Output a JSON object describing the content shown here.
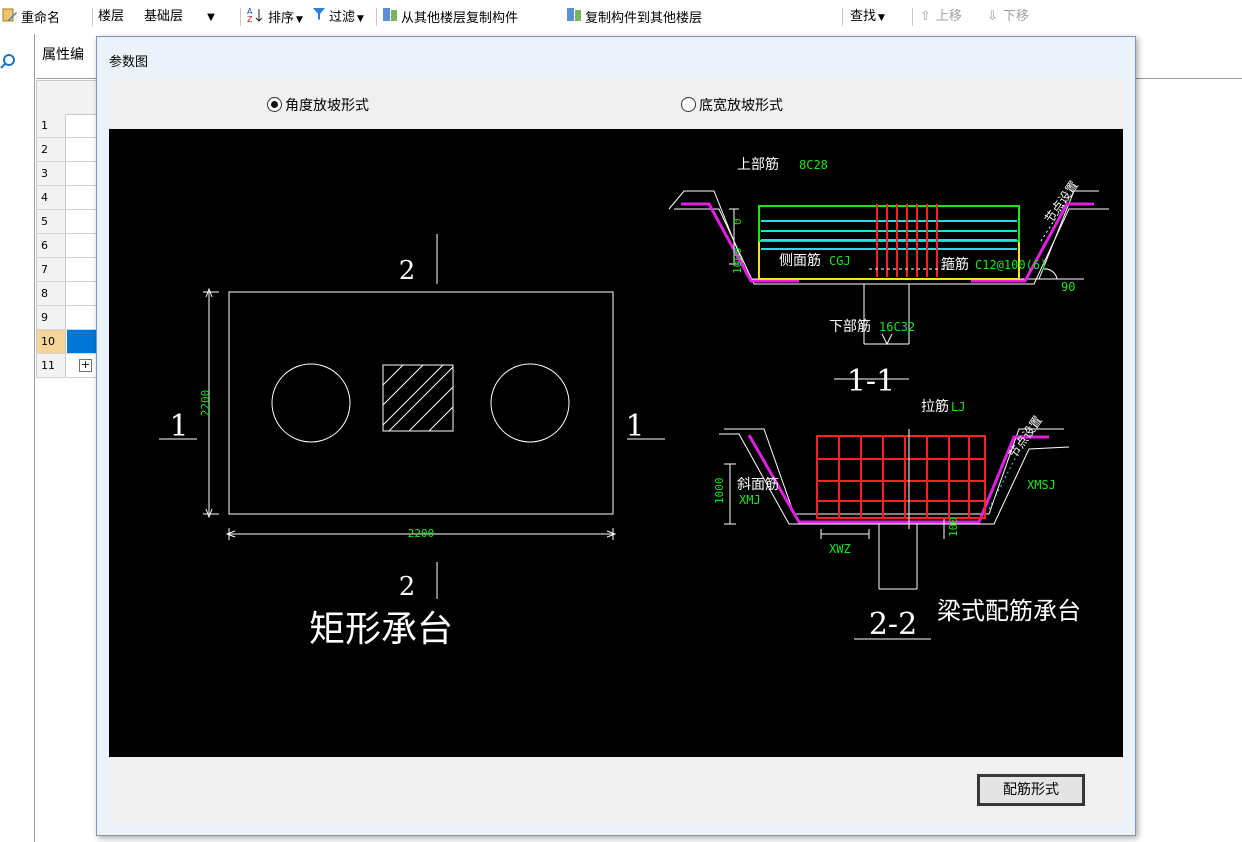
{
  "toolbar": {
    "rename": "重命名",
    "floor_label": "楼层",
    "floor_value": "基础层",
    "sort": "排序",
    "filter": "过滤",
    "copy_from": "从其他楼层复制构件",
    "copy_to": "复制构件到其他楼层",
    "find": "查找",
    "move_up": "上移",
    "move_down": "下移"
  },
  "panel": {
    "tab_label": "属性编"
  },
  "grid": {
    "rows": [
      "1",
      "2",
      "3",
      "4",
      "5",
      "6",
      "7",
      "8",
      "9",
      "10",
      "11"
    ],
    "selected_row": "10",
    "expand_symbol": "+"
  },
  "dialog": {
    "title": "参数图",
    "radio_angle": "角度放坡形式",
    "radio_width": "底宽放坡形式",
    "button": "配筋形式"
  },
  "drawing": {
    "left": {
      "dim_w": "2200",
      "dim_h": "2200",
      "sec1": "1",
      "sec2": "2",
      "caption": "矩形承台"
    },
    "s11": {
      "top_bar": "上部筋",
      "top_bar_val": "8C28",
      "side_bar": "侧面筋",
      "side_bar_val": "CGJ",
      "stirrup": "箍筋",
      "stirrup_val": "C12@100(6)",
      "bottom_bar": "下部筋",
      "bottom_bar_val": "16C32",
      "dim_zero": "0",
      "dim_h": "1000",
      "angle": "90",
      "note": "节点设置",
      "label": "1-1"
    },
    "s22": {
      "tie": "拉筋",
      "tie_val": "LJ",
      "slope": "斜面筋",
      "slope_val": "XMJ",
      "xmsj": "XMSJ",
      "xwz": "XWZ",
      "dim_h": "1000",
      "dim_small": "100",
      "note": "节点设置",
      "label": "2-2",
      "caption": "梁式配筋承台"
    }
  },
  "colors": {
    "canvas": "#000000",
    "selected": "#0078d7",
    "rebar_red": "#ff2020",
    "rebar_green": "#19e619",
    "magenta": "#e020e0"
  }
}
